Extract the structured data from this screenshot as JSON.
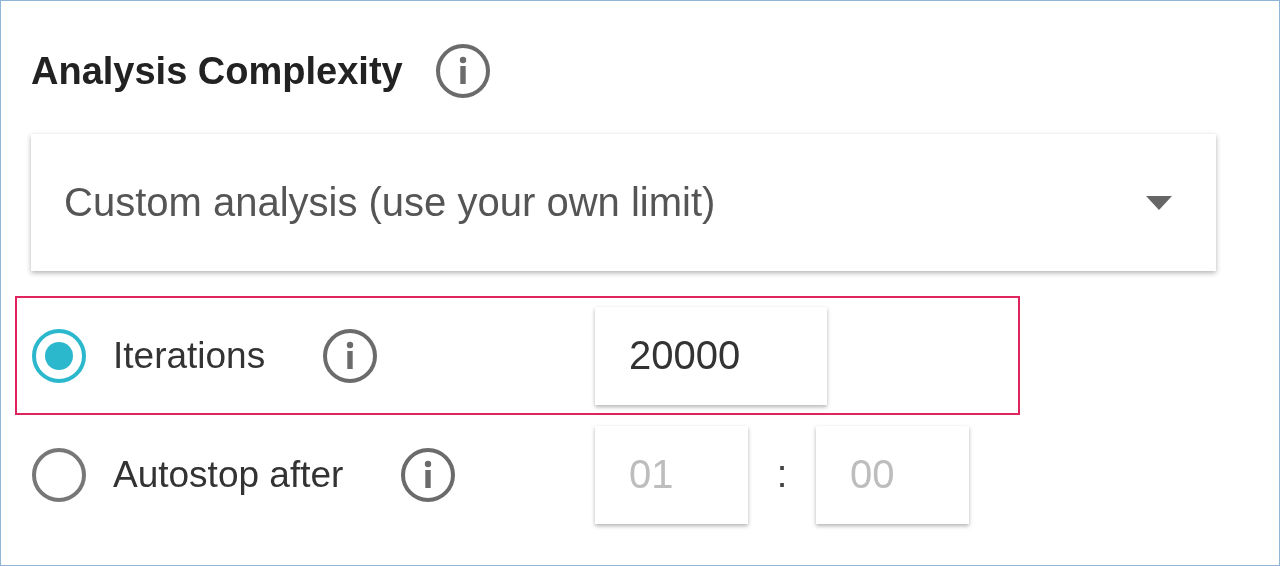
{
  "title": "Analysis Complexity",
  "dropdown": {
    "value": "Custom analysis (use your own limit)"
  },
  "options": [
    {
      "label": "Iterations",
      "selected": true,
      "highlighted": true,
      "fields": [
        {
          "value": "20000",
          "disabled": false
        }
      ]
    },
    {
      "label": "Autostop after",
      "selected": false,
      "highlighted": false,
      "separator": ":",
      "fields": [
        {
          "value": "01",
          "disabled": true
        },
        {
          "value": "00",
          "disabled": true
        }
      ]
    }
  ]
}
